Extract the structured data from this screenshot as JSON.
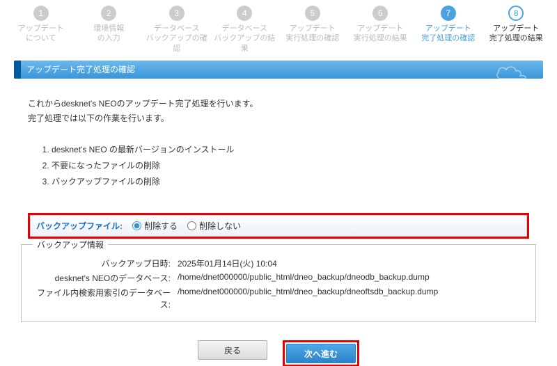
{
  "steps": [
    {
      "num": "1",
      "line1": "アップデート",
      "line2": "について"
    },
    {
      "num": "2",
      "line1": "環境情報",
      "line2": "の入力"
    },
    {
      "num": "3",
      "line1": "データベース",
      "line2": "バックアップの確認"
    },
    {
      "num": "4",
      "line1": "データベース",
      "line2": "バックアップの結果"
    },
    {
      "num": "5",
      "line1": "アップデート",
      "line2": "実行処理の確認"
    },
    {
      "num": "6",
      "line1": "アップデート",
      "line2": "実行処理の結果"
    },
    {
      "num": "7",
      "line1": "アップデート",
      "line2": "完了処理の確認"
    },
    {
      "num": "8",
      "line1": "アップデート",
      "line2": "完了処理の結果"
    }
  ],
  "section_title": "アップデート完了処理の確認",
  "intro": {
    "p1": "これからdesknet's NEOのアップデート完了処理を行います。",
    "p2": "完了処理では以下の作業を行います。"
  },
  "tasks": [
    "desknet's NEO の最新バージョンのインストール",
    "不要になったファイルの削除",
    "バックアップファイルの削除"
  ],
  "backup_option": {
    "label": "バックアップファイル:",
    "opt_delete": "削除する",
    "opt_keep": "削除しない"
  },
  "fieldset": {
    "legend": "バックアップ情報",
    "rows": [
      {
        "k": "バックアップ日時:",
        "v": "2025年01月14日(火) 10:04"
      },
      {
        "k": "desknet's NEOのデータベース:",
        "v": "/home/dnet000000/public_html/dneo_backup/dneodb_backup.dump"
      },
      {
        "k": "ファイル内検索用索引のデータベース:",
        "v": "/home/dnet000000/public_html/dneo_backup/dneoftsdb_backup.dump"
      }
    ]
  },
  "buttons": {
    "back": "戻る",
    "next": "次へ進む"
  }
}
